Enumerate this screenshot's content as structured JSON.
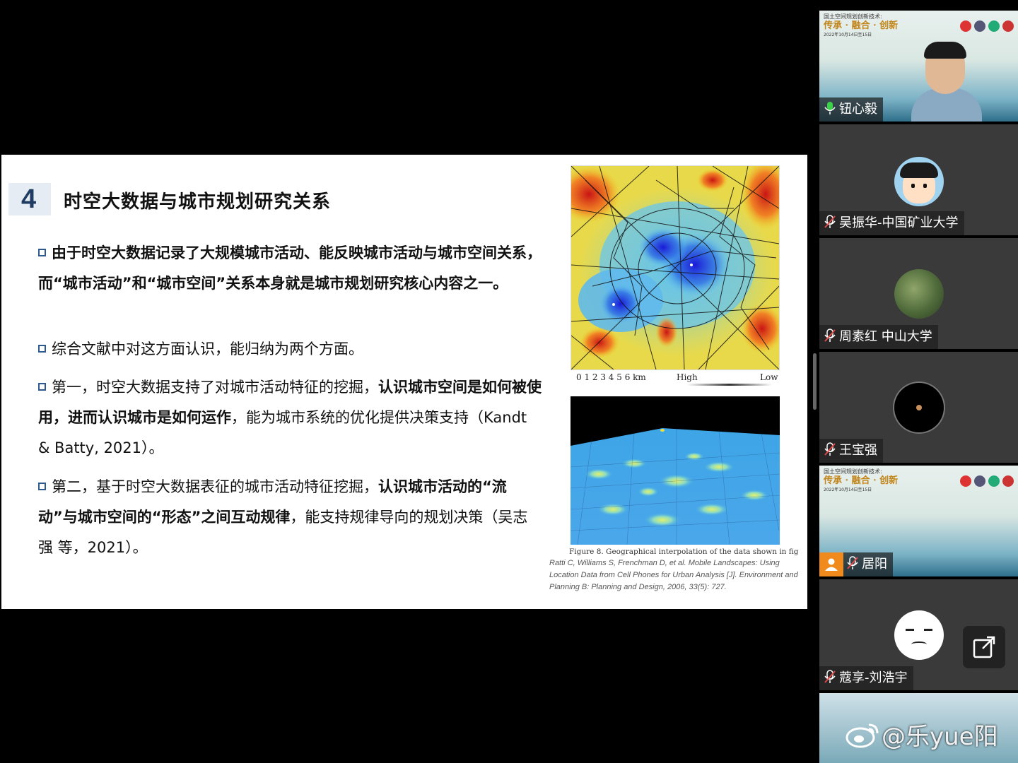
{
  "slide": {
    "section_number": "4",
    "title": "时空大数据与城市规划研究关系",
    "bullets": [
      {
        "id": "b1",
        "bold_text": "由于时空大数据记录了大规模城市活动、能反映城市活动与城市空间关系，而“城市活动”和“城市空间”关系本身就是城市规划研究核心内容之一。"
      },
      {
        "id": "b2",
        "text": "综合文献中对这方面认识，能归纳为两个方面。"
      },
      {
        "id": "b3",
        "pre": "第一，时空大数据支持了对城市活动特征的挖掘，",
        "bold": "认识城市空间是如何被使用，进而认识城市是如何运作",
        "post": "，能为城市系统的优化提供决策支持（Kandt & Batty, 2021）。"
      },
      {
        "id": "b4",
        "pre": "第二，基于时空大数据表征的城市活动特征挖掘，",
        "bold": "认识城市活动的“流动”与城市空间的“形态”之间互动规律",
        "post": "，能支持规律导向的规划决策（吴志强 等，2021）。"
      }
    ],
    "map_scale": "0 1 2 3 4 5 6 km",
    "legend_high": "High",
    "legend_low": "Low",
    "figure_caption": "Figure 8. Geographical interpolation of the data shown in fig",
    "reference": "Ratti C, Williams S, Frenchman D, et al. Mobile Landscapes: Using Location Data from Cell Phones for Urban Analysis [J]. Environment and Planning B: Planning and Design, 2006, 33(5): 727."
  },
  "conference_banner": {
    "heading": "国土空间规划创新技术:",
    "slogan": "传承 · 融合 · 创新",
    "subtitle": "研讨会",
    "date": "2022年10月14日至15日"
  },
  "participants": [
    {
      "name": "钮心毅",
      "mic": "on",
      "type": "conference"
    },
    {
      "name": "吴振华-中国矿业大学",
      "mic": "off",
      "type": "avatar-cartoon"
    },
    {
      "name": "周素红 中山大学",
      "mic": "off",
      "type": "avatar-tree"
    },
    {
      "name": "王宝强",
      "mic": "off",
      "type": "avatar-dark"
    },
    {
      "name": "居阳",
      "mic": "off",
      "type": "conference"
    },
    {
      "name": "蔻享-刘浩宇",
      "mic": "off",
      "type": "avatar-emoji"
    }
  ],
  "watermark": "@乐yue阳",
  "colors": {
    "accent": "#2d5b8f",
    "title_num": "#1f3d63",
    "label_bg": "#1e1e1e",
    "mic_on": "#3bd14a",
    "mic_off": "#e04a4a"
  }
}
